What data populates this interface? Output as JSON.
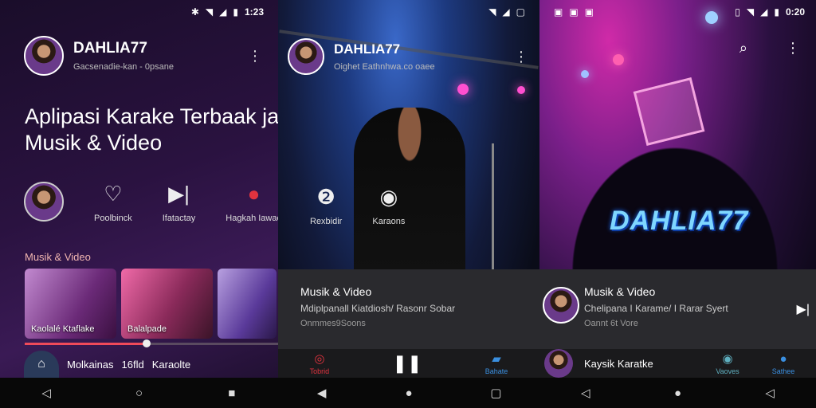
{
  "panels": {
    "p1": {
      "status_time": "1:23",
      "channel_name": "DAHLIA77",
      "channel_sub": "Gacsenadie-kan - 0psane",
      "hero_title": "Aplipasi Karake Terbaak jatar Yaal\nMusik & Video",
      "quick_actions": [
        {
          "label": "Poolbinck",
          "icon": "book-heart-icon"
        },
        {
          "label": "Ifatactay",
          "icon": "skip-icon"
        },
        {
          "label": "Hagkah Iawae",
          "icon": "sad-face-icon"
        }
      ],
      "section_title": "Musik & Video",
      "thumbs": [
        {
          "label": "Kaolalé Ktaflake"
        },
        {
          "label": "Balalpade"
        },
        {
          "label": ""
        }
      ],
      "progress": 0.48,
      "mini_player": {
        "title": "Molkainas",
        "extra": "16fld",
        "tag": "Karaolte"
      }
    },
    "p2": {
      "channel_name": "DAHLIA77",
      "channel_sub": "Oighet Eathnhwa.co oaee",
      "overlay_actions": [
        {
          "label": "Rexbidir"
        },
        {
          "label": "Karaons"
        }
      ],
      "card": {
        "title": "Musik & Video",
        "sub": "Mdiplpanall Kiatdiosh/ Rasonr Sobar",
        "meta": "Onmmes9Soons"
      },
      "tabs": [
        {
          "label": "Tobrid",
          "icon": "disc-icon"
        },
        {
          "label": "",
          "icon": "pause-icon"
        },
        {
          "label": "Bahate",
          "icon": "bookmark-icon"
        }
      ]
    },
    "p3": {
      "status_time": "0:20",
      "brand": "DAHLIA77",
      "card": {
        "title": "Musik & Video",
        "sub": "Chelipana I Karame/ I Rarar Syert",
        "meta": "Oannt 6t Vore"
      },
      "now_playing": "Kaysik Karatke",
      "tabs": [
        {
          "label": "Vaoves",
          "icon": "spiral-icon"
        },
        {
          "label": "Sathee",
          "icon": "info-icon"
        }
      ]
    }
  },
  "colors": {
    "accent": "#f04a5a",
    "brand_blue": "#7fd7ff"
  }
}
